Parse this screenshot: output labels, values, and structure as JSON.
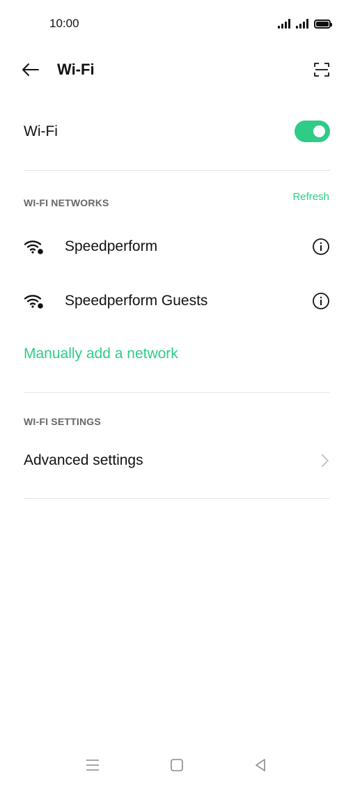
{
  "status_bar": {
    "time": "10:00"
  },
  "header": {
    "title": "Wi-Fi",
    "back_icon": "arrow-left-icon",
    "scan_icon": "qr-scan-icon"
  },
  "wifi_toggle": {
    "label": "Wi-Fi",
    "enabled": true
  },
  "networks_section": {
    "title": "WI-FI NETWORKS",
    "refresh_label": "Refresh",
    "networks": [
      {
        "name": "Speedperform",
        "icon": "wifi-locked-icon"
      },
      {
        "name": "Speedperform Guests",
        "icon": "wifi-locked-icon"
      }
    ],
    "manual_add_label": "Manually add a network"
  },
  "settings_section": {
    "title": "WI-FI SETTINGS",
    "items": [
      {
        "label": "Advanced settings"
      }
    ]
  },
  "colors": {
    "accent": "#2ecc86",
    "text": "#111111",
    "section_header": "#666666",
    "divider": "#e6e6e6"
  }
}
